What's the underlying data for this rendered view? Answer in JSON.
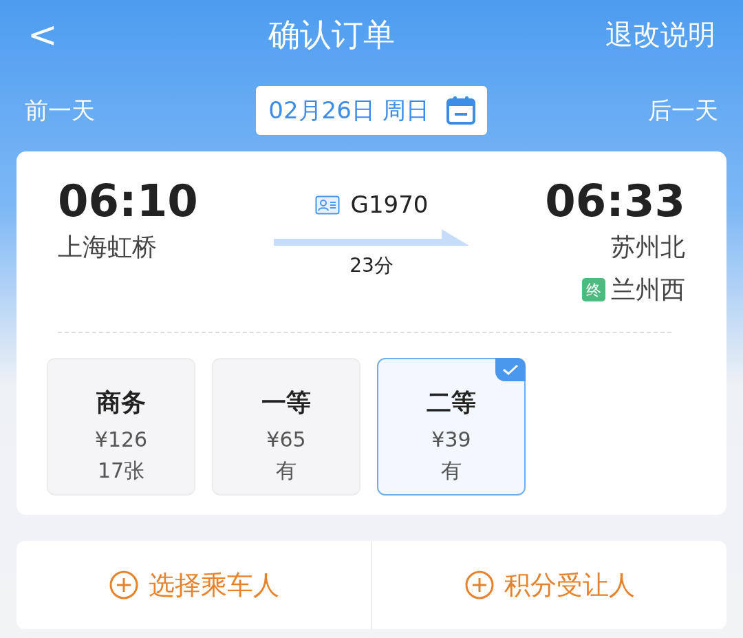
{
  "header": {
    "back": "<",
    "title": "确认订单",
    "action": "退改说明"
  },
  "date_bar": {
    "prev": "前一天",
    "date": "02月26日 周日",
    "next": "后一天"
  },
  "train": {
    "depart_time": "06:10",
    "depart_station": "上海虹桥",
    "number": "G1970",
    "duration": "23分",
    "arrive_time": "06:33",
    "arrive_station": "苏州北",
    "terminal_badge": "终",
    "terminal_station": "兰州西"
  },
  "seats": [
    {
      "name": "商务",
      "price": "¥126",
      "availability": "17张",
      "selected": false
    },
    {
      "name": "一等",
      "price": "¥65",
      "availability": "有",
      "selected": false
    },
    {
      "name": "二等",
      "price": "¥39",
      "availability": "有",
      "selected": true
    }
  ],
  "actions": [
    {
      "label": "选择乘车人"
    },
    {
      "label": "积分受让人"
    }
  ]
}
